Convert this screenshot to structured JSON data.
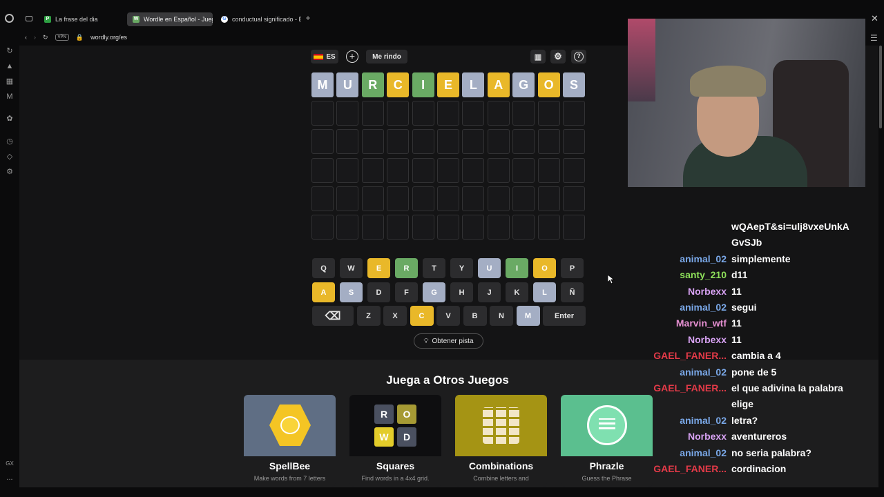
{
  "browser": {
    "tabs": [
      {
        "label": "La frase del dia",
        "favicon": "P",
        "favicon_color": "#2ea043"
      },
      {
        "label": "Wordle en Español - Jueg",
        "favicon": "W",
        "favicon_color": "#6aaa64"
      },
      {
        "label": "conductual significado - B",
        "favicon": "G",
        "favicon_color": "#4285f4"
      }
    ],
    "url": "wordly.org/es",
    "vpn_label": "VPN"
  },
  "toolbar": {
    "language": "ES",
    "give_up_label": "Me rindo"
  },
  "board": {
    "guess": {
      "letters": [
        "M",
        "U",
        "R",
        "C",
        "I",
        "E",
        "L",
        "A",
        "G",
        "O",
        "S"
      ],
      "states": [
        "absent",
        "absent",
        "correct",
        "present",
        "correct",
        "present",
        "absent",
        "present",
        "absent",
        "present",
        "absent"
      ]
    },
    "empty_rows": 5
  },
  "keyboard": {
    "rows": [
      [
        {
          "k": "Q",
          "s": ""
        },
        {
          "k": "W",
          "s": ""
        },
        {
          "k": "E",
          "s": "present"
        },
        {
          "k": "R",
          "s": "correct"
        },
        {
          "k": "T",
          "s": ""
        },
        {
          "k": "Y",
          "s": ""
        },
        {
          "k": "U",
          "s": "absent"
        },
        {
          "k": "I",
          "s": "correct"
        },
        {
          "k": "O",
          "s": "present"
        },
        {
          "k": "P",
          "s": ""
        }
      ],
      [
        {
          "k": "A",
          "s": "present"
        },
        {
          "k": "S",
          "s": "absent"
        },
        {
          "k": "D",
          "s": ""
        },
        {
          "k": "F",
          "s": ""
        },
        {
          "k": "G",
          "s": "absent"
        },
        {
          "k": "H",
          "s": ""
        },
        {
          "k": "J",
          "s": ""
        },
        {
          "k": "K",
          "s": ""
        },
        {
          "k": "L",
          "s": "absent"
        },
        {
          "k": "Ñ",
          "s": ""
        }
      ],
      [
        {
          "k": "⌫",
          "s": ""
        },
        {
          "k": "Z",
          "s": ""
        },
        {
          "k": "X",
          "s": ""
        },
        {
          "k": "C",
          "s": "present"
        },
        {
          "k": "V",
          "s": ""
        },
        {
          "k": "B",
          "s": ""
        },
        {
          "k": "N",
          "s": ""
        },
        {
          "k": "M",
          "s": "absent"
        },
        {
          "k": "Enter",
          "s": ""
        }
      ]
    ]
  },
  "colors": {
    "correct": "#6aaa64",
    "present": "#e9b829",
    "absent": "#a4aec4"
  },
  "hint_label": "Obtener pista",
  "other_games": {
    "title": "Juega a Otros Juegos",
    "cards": [
      {
        "title": "SpellBee",
        "desc": "Make words from 7 letters"
      },
      {
        "title": "Squares",
        "desc": "Find words in a 4x4 grid."
      },
      {
        "title": "Combinations",
        "desc": "Combine letters and"
      },
      {
        "title": "Phrazle",
        "desc": "Guess the Phrase"
      }
    ],
    "squares_letters": [
      "R",
      "O",
      "W",
      "D"
    ]
  },
  "chat": [
    {
      "user": "",
      "msg": "wQAepT&si=ulj8vxeUnkA",
      "color": "#ffffff"
    },
    {
      "user": "",
      "msg": "GvSJb",
      "color": "#ffffff"
    },
    {
      "user": "animal_02",
      "msg": "simplemente",
      "color": "#7aa8e8"
    },
    {
      "user": "santy_210",
      "msg": "d11",
      "color": "#8ee05a"
    },
    {
      "user": "Norbexx",
      "msg": "11",
      "color": "#d9a3f5"
    },
    {
      "user": "animal_02",
      "msg": "segui",
      "color": "#7aa8e8"
    },
    {
      "user": "Marvin_wtf",
      "msg": "11",
      "color": "#e58fd1"
    },
    {
      "user": "Norbexx",
      "msg": "11",
      "color": "#d9a3f5"
    },
    {
      "user": "GAEL_FANER...",
      "msg": "cambia a 4",
      "color": "#e33a48"
    },
    {
      "user": "animal_02",
      "msg": "pone de 5",
      "color": "#7aa8e8"
    },
    {
      "user": "GAEL_FANER...",
      "msg": "el que adivina la palabra",
      "color": "#e33a48"
    },
    {
      "user": "",
      "msg": "elige",
      "color": "#ffffff"
    },
    {
      "user": "animal_02",
      "msg": "letra?",
      "color": "#7aa8e8"
    },
    {
      "user": "Norbexx",
      "msg": "aventureros",
      "color": "#d9a3f5"
    },
    {
      "user": "animal_02",
      "msg": "no seria palabra?",
      "color": "#7aa8e8"
    },
    {
      "user": "GAEL_FANER...",
      "msg": "cordinacion",
      "color": "#e33a48"
    }
  ],
  "sidebar": {
    "gx_label": "GX",
    "more_label": "..."
  }
}
